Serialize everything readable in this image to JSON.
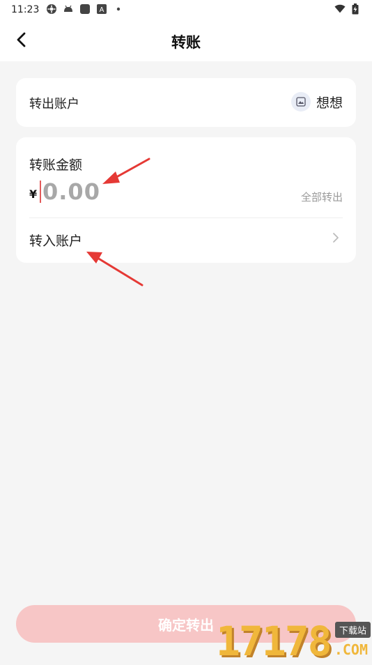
{
  "status_bar": {
    "time": "11:23",
    "icons": [
      "settings-gear-icon",
      "android-icon",
      "app-square-icon",
      "a-badge-icon",
      "dot-icon"
    ],
    "right_icons": [
      "wifi-icon",
      "battery-icon"
    ]
  },
  "nav": {
    "title": "转账",
    "back_icon": "back-arrow-icon"
  },
  "from_account": {
    "label": "转出账户",
    "name": "想想",
    "avatar_icon": "avatar-icon"
  },
  "amount": {
    "label": "转账金额",
    "currency": "¥",
    "placeholder": "0.00",
    "all_out": "全部转出"
  },
  "to_account": {
    "label": "转入账户",
    "chevron_icon": "chevron-right-icon"
  },
  "confirm_button": {
    "label": "确定转出"
  },
  "watermark": {
    "digits": "17178",
    "tag": "下载站",
    "domain": ".COM"
  },
  "colors": {
    "accent": "#f7c6c6",
    "annotation": "#e53935",
    "background": "#f5f5f5"
  }
}
